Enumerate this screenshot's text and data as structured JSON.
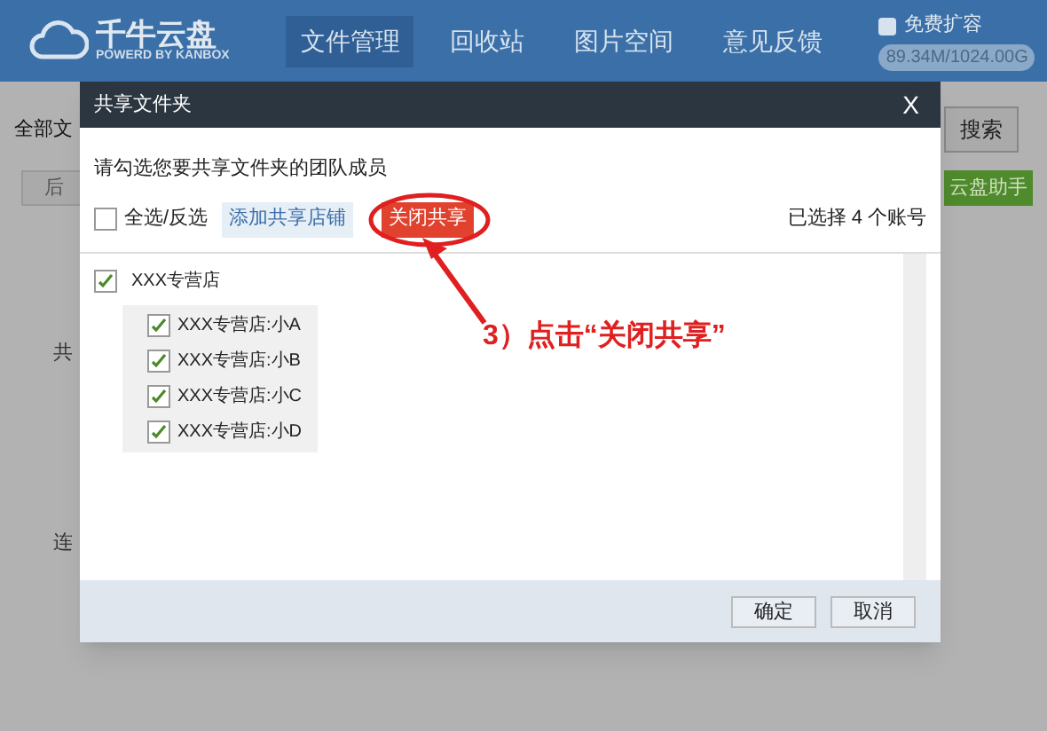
{
  "header": {
    "logo_title": "千牛云盘",
    "logo_subtitle": "POWERD BY KANBOX",
    "nav": [
      {
        "label": "文件管理",
        "selected": true
      },
      {
        "label": "回收站",
        "selected": false
      },
      {
        "label": "图片空间",
        "selected": false
      },
      {
        "label": "意见反馈",
        "selected": false
      }
    ],
    "expand_link": "免费扩容",
    "storage": "89.34M/1024.00G"
  },
  "background": {
    "breadcrumb": "全部文",
    "back_button": "后",
    "search_button": "搜索",
    "assistant_button": "云盘助手",
    "folder_labels": [
      "共",
      "连"
    ]
  },
  "dialog": {
    "title": "共享文件夹",
    "close": "X",
    "instruction": "请勾选您要共享文件夹的团队成员",
    "select_all": {
      "label": "全选/反选",
      "checked": false
    },
    "add_button": "添加共享店铺",
    "close_share_button": "关闭共享",
    "selected_count": "已选择 4 个账号",
    "tree": {
      "label": "XXX专营店",
      "checked": true,
      "children": [
        {
          "label": "XXX专营店:小A",
          "checked": true
        },
        {
          "label": "XXX专营店:小B",
          "checked": true
        },
        {
          "label": "XXX专营店:小C",
          "checked": true
        },
        {
          "label": "XXX专营店:小D",
          "checked": true
        }
      ]
    },
    "buttons": [
      "确定",
      "取消"
    ]
  },
  "annotation": {
    "text": "3）点击“关闭共享”"
  }
}
